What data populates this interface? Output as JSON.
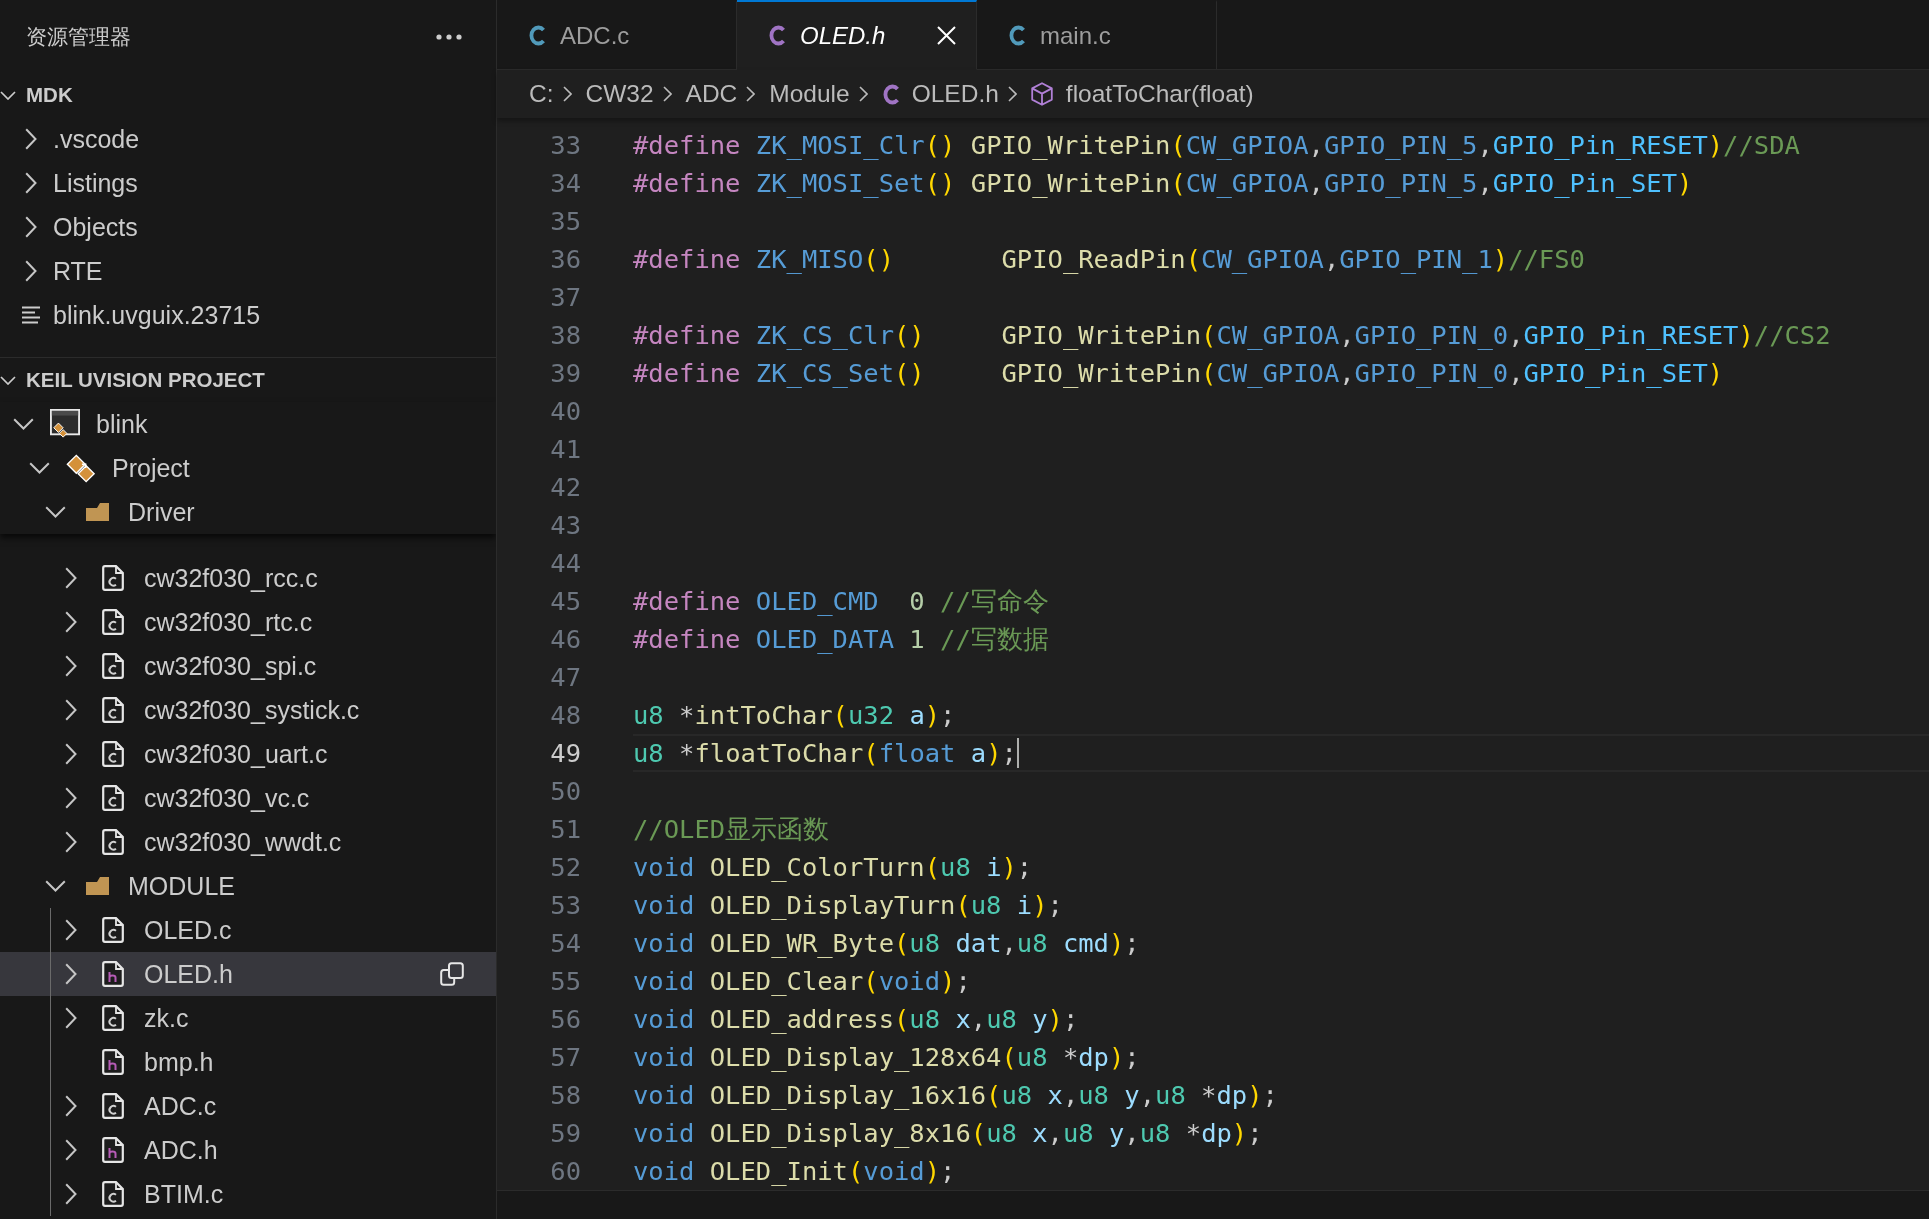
{
  "sidebar": {
    "title": "资源管理器",
    "sections": [
      {
        "title": "MDK",
        "kind": "explorer",
        "expanded": true,
        "items": [
          {
            "label": ".vscode",
            "kind": "dir",
            "expandable": true,
            "expanded": false,
            "selected": false
          },
          {
            "label": "Listings",
            "kind": "dir",
            "expandable": true,
            "expanded": false,
            "selected": false
          },
          {
            "label": "Objects",
            "kind": "dir",
            "expandable": true,
            "expanded": false,
            "selected": false
          },
          {
            "label": "RTE",
            "kind": "dir",
            "expandable": true,
            "expanded": false,
            "selected": false
          },
          {
            "label": "blink.uvguix.23715",
            "kind": "text-file",
            "expandable": false,
            "selected": false
          }
        ]
      },
      {
        "title": "KEIL UVISION PROJECT",
        "kind": "project",
        "expanded": true,
        "items": [
          {
            "label": "blink",
            "kind": "target",
            "expandable": true,
            "expanded": true,
            "selected": false,
            "children": [
              {
                "label": "Project",
                "kind": "project",
                "expandable": true,
                "expanded": true,
                "selected": false,
                "children": [
                  {
                    "label": "Driver",
                    "kind": "folder",
                    "expandable": true,
                    "expanded": true,
                    "selected": false,
                    "children": [
                      {
                        "label": "cw32f030_rcc.c",
                        "kind": "c-file",
                        "expandable": true,
                        "expanded": false,
                        "selected": false
                      },
                      {
                        "label": "cw32f030_rtc.c",
                        "kind": "c-file",
                        "expandable": true,
                        "expanded": false,
                        "selected": false
                      },
                      {
                        "label": "cw32f030_spi.c",
                        "kind": "c-file",
                        "expandable": true,
                        "expanded": false,
                        "selected": false
                      },
                      {
                        "label": "cw32f030_systick.c",
                        "kind": "c-file",
                        "expandable": true,
                        "expanded": false,
                        "selected": false
                      },
                      {
                        "label": "cw32f030_uart.c",
                        "kind": "c-file",
                        "expandable": true,
                        "expanded": false,
                        "selected": false
                      },
                      {
                        "label": "cw32f030_vc.c",
                        "kind": "c-file",
                        "expandable": true,
                        "expanded": false,
                        "selected": false
                      },
                      {
                        "label": "cw32f030_wwdt.c",
                        "kind": "c-file",
                        "expandable": true,
                        "expanded": false,
                        "selected": false
                      }
                    ]
                  },
                  {
                    "label": "MODULE",
                    "kind": "folder",
                    "expandable": true,
                    "expanded": true,
                    "selected": false,
                    "children": [
                      {
                        "label": "OLED.c",
                        "kind": "c-file",
                        "expandable": true,
                        "expanded": false,
                        "selected": false
                      },
                      {
                        "label": "OLED.h",
                        "kind": "h-file",
                        "expandable": true,
                        "expanded": false,
                        "selected": true
                      },
                      {
                        "label": "zk.c",
                        "kind": "c-file",
                        "expandable": true,
                        "expanded": false,
                        "selected": false
                      },
                      {
                        "label": "bmp.h",
                        "kind": "h-file",
                        "expandable": false,
                        "selected": false
                      },
                      {
                        "label": "ADC.c",
                        "kind": "c-file",
                        "expandable": true,
                        "expanded": false,
                        "selected": false
                      },
                      {
                        "label": "ADC.h",
                        "kind": "h-file",
                        "expandable": true,
                        "expanded": false,
                        "selected": false
                      },
                      {
                        "label": "BTIM.c",
                        "kind": "c-file",
                        "expandable": true,
                        "expanded": false,
                        "selected": false
                      }
                    ]
                  }
                ]
              }
            ]
          }
        ]
      }
    ]
  },
  "tabs": [
    {
      "label": "ADC.c",
      "kind": "source",
      "selected": false,
      "preview": false
    },
    {
      "label": "OLED.h",
      "kind": "header",
      "selected": true,
      "preview": true
    },
    {
      "label": "main.c",
      "kind": "source",
      "selected": false,
      "preview": false
    }
  ],
  "breadcrumbs": [
    {
      "label": "C:",
      "kind": "folder"
    },
    {
      "label": "CW32",
      "kind": "folder"
    },
    {
      "label": "ADC",
      "kind": "folder"
    },
    {
      "label": "Module",
      "kind": "folder"
    },
    {
      "label": "OLED.h",
      "kind": "header"
    },
    {
      "label": "floatToChar(float)",
      "kind": "function"
    }
  ],
  "editor": {
    "lines": [
      {
        "number": "33",
        "active": false,
        "tokens": [
          {
            "kind": "directive",
            "text": "#define "
          },
          {
            "kind": "macro",
            "text": "ZK_MOSI_Clr"
          },
          {
            "kind": "bracket",
            "text": "() "
          },
          {
            "kind": "function",
            "text": "GPIO_WritePin"
          },
          {
            "kind": "bracket",
            "text": "("
          },
          {
            "kind": "macro",
            "text": "CW_GPIOA"
          },
          {
            "kind": "plain",
            "text": ","
          },
          {
            "kind": "macro",
            "text": "GPIO_PIN_5"
          },
          {
            "kind": "plain",
            "text": ","
          },
          {
            "kind": "constant",
            "text": "GPIO_Pin_RESET"
          },
          {
            "kind": "bracket",
            "text": ")"
          },
          {
            "kind": "comment",
            "text": "//SDA"
          }
        ]
      },
      {
        "number": "34",
        "active": false,
        "tokens": [
          {
            "kind": "directive",
            "text": "#define "
          },
          {
            "kind": "macro",
            "text": "ZK_MOSI_Set"
          },
          {
            "kind": "bracket",
            "text": "() "
          },
          {
            "kind": "function",
            "text": "GPIO_WritePin"
          },
          {
            "kind": "bracket",
            "text": "("
          },
          {
            "kind": "macro",
            "text": "CW_GPIOA"
          },
          {
            "kind": "plain",
            "text": ","
          },
          {
            "kind": "macro",
            "text": "GPIO_PIN_5"
          },
          {
            "kind": "plain",
            "text": ","
          },
          {
            "kind": "constant",
            "text": "GPIO_Pin_SET"
          },
          {
            "kind": "bracket",
            "text": ")"
          }
        ]
      },
      {
        "number": "35",
        "active": false
      },
      {
        "number": "36",
        "active": false,
        "tokens": [
          {
            "kind": "directive",
            "text": "#define "
          },
          {
            "kind": "macro",
            "text": "ZK_MISO"
          },
          {
            "kind": "bracket",
            "text": "()       "
          },
          {
            "kind": "function",
            "text": "GPIO_ReadPin"
          },
          {
            "kind": "bracket",
            "text": "("
          },
          {
            "kind": "macro",
            "text": "CW_GPIOA"
          },
          {
            "kind": "plain",
            "text": ","
          },
          {
            "kind": "macro",
            "text": "GPIO_PIN_1"
          },
          {
            "kind": "bracket",
            "text": ")"
          },
          {
            "kind": "comment",
            "text": "//FS0"
          }
        ]
      },
      {
        "number": "37",
        "active": false
      },
      {
        "number": "38",
        "active": false,
        "tokens": [
          {
            "kind": "directive",
            "text": "#define "
          },
          {
            "kind": "macro",
            "text": "ZK_CS_Clr"
          },
          {
            "kind": "bracket",
            "text": "()     "
          },
          {
            "kind": "function",
            "text": "GPIO_WritePin"
          },
          {
            "kind": "bracket",
            "text": "("
          },
          {
            "kind": "macro",
            "text": "CW_GPIOA"
          },
          {
            "kind": "plain",
            "text": ","
          },
          {
            "kind": "macro",
            "text": "GPIO_PIN_0"
          },
          {
            "kind": "plain",
            "text": ","
          },
          {
            "kind": "constant",
            "text": "GPIO_Pin_RESET"
          },
          {
            "kind": "bracket",
            "text": ")"
          },
          {
            "kind": "comment",
            "text": "//CS2"
          }
        ]
      },
      {
        "number": "39",
        "active": false,
        "tokens": [
          {
            "kind": "directive",
            "text": "#define "
          },
          {
            "kind": "macro",
            "text": "ZK_CS_Set"
          },
          {
            "kind": "bracket",
            "text": "()     "
          },
          {
            "kind": "function",
            "text": "GPIO_WritePin"
          },
          {
            "kind": "bracket",
            "text": "("
          },
          {
            "kind": "macro",
            "text": "CW_GPIOA"
          },
          {
            "kind": "plain",
            "text": ","
          },
          {
            "kind": "macro",
            "text": "GPIO_PIN_0"
          },
          {
            "kind": "plain",
            "text": ","
          },
          {
            "kind": "constant",
            "text": "GPIO_Pin_SET"
          },
          {
            "kind": "bracket",
            "text": ")"
          }
        ]
      },
      {
        "number": "40",
        "active": false
      },
      {
        "number": "41",
        "active": false
      },
      {
        "number": "42",
        "active": false
      },
      {
        "number": "43",
        "active": false
      },
      {
        "number": "44",
        "active": false
      },
      {
        "number": "45",
        "active": false,
        "tokens": [
          {
            "kind": "directive",
            "text": "#define "
          },
          {
            "kind": "macro",
            "text": "OLED_CMD  "
          },
          {
            "kind": "number",
            "text": "0 "
          },
          {
            "kind": "comment",
            "text": "//写命令"
          }
        ]
      },
      {
        "number": "46",
        "active": false,
        "tokens": [
          {
            "kind": "directive",
            "text": "#define "
          },
          {
            "kind": "macro",
            "text": "OLED_DATA "
          },
          {
            "kind": "number",
            "text": "1 "
          },
          {
            "kind": "comment",
            "text": "//写数据"
          }
        ]
      },
      {
        "number": "47",
        "active": false
      },
      {
        "number": "48",
        "active": false,
        "tokens": [
          {
            "kind": "type",
            "text": "u8"
          },
          {
            "kind": "plain",
            "text": " *"
          },
          {
            "kind": "function",
            "text": "intToChar"
          },
          {
            "kind": "bracket",
            "text": "("
          },
          {
            "kind": "type",
            "text": "u32 "
          },
          {
            "kind": "param",
            "text": "a"
          },
          {
            "kind": "bracket",
            "text": ")"
          },
          {
            "kind": "plain",
            "text": ";"
          }
        ]
      },
      {
        "number": "49",
        "active": true,
        "tokens": [
          {
            "kind": "type",
            "text": "u8"
          },
          {
            "kind": "plain",
            "text": " *"
          },
          {
            "kind": "function",
            "text": "floatToChar"
          },
          {
            "kind": "bracket",
            "text": "("
          },
          {
            "kind": "keyword",
            "text": "float "
          },
          {
            "kind": "param",
            "text": "a"
          },
          {
            "kind": "bracket",
            "text": ")"
          },
          {
            "kind": "plain",
            "text": ";"
          }
        ]
      },
      {
        "number": "50",
        "active": false
      },
      {
        "number": "51",
        "active": false,
        "tokens": [
          {
            "kind": "comment",
            "text": "//OLED显示函数"
          }
        ]
      },
      {
        "number": "52",
        "active": false,
        "tokens": [
          {
            "kind": "keyword",
            "text": "void "
          },
          {
            "kind": "function",
            "text": "OLED_ColorTurn"
          },
          {
            "kind": "bracket",
            "text": "("
          },
          {
            "kind": "type",
            "text": "u8 "
          },
          {
            "kind": "param",
            "text": "i"
          },
          {
            "kind": "bracket",
            "text": ")"
          },
          {
            "kind": "plain",
            "text": ";"
          }
        ]
      },
      {
        "number": "53",
        "active": false,
        "tokens": [
          {
            "kind": "keyword",
            "text": "void "
          },
          {
            "kind": "function",
            "text": "OLED_DisplayTurn"
          },
          {
            "kind": "bracket",
            "text": "("
          },
          {
            "kind": "type",
            "text": "u8 "
          },
          {
            "kind": "param",
            "text": "i"
          },
          {
            "kind": "bracket",
            "text": ")"
          },
          {
            "kind": "plain",
            "text": ";"
          }
        ]
      },
      {
        "number": "54",
        "active": false,
        "tokens": [
          {
            "kind": "keyword",
            "text": "void "
          },
          {
            "kind": "function",
            "text": "OLED_WR_Byte"
          },
          {
            "kind": "bracket",
            "text": "("
          },
          {
            "kind": "type",
            "text": "u8 "
          },
          {
            "kind": "param",
            "text": "dat"
          },
          {
            "kind": "plain",
            "text": ","
          },
          {
            "kind": "type",
            "text": "u8 "
          },
          {
            "kind": "param",
            "text": "cmd"
          },
          {
            "kind": "bracket",
            "text": ")"
          },
          {
            "kind": "plain",
            "text": ";"
          }
        ]
      },
      {
        "number": "55",
        "active": false,
        "tokens": [
          {
            "kind": "keyword",
            "text": "void "
          },
          {
            "kind": "function",
            "text": "OLED_Clear"
          },
          {
            "kind": "bracket",
            "text": "("
          },
          {
            "kind": "keyword",
            "text": "void"
          },
          {
            "kind": "bracket",
            "text": ")"
          },
          {
            "kind": "plain",
            "text": ";"
          }
        ]
      },
      {
        "number": "56",
        "active": false,
        "tokens": [
          {
            "kind": "keyword",
            "text": "void "
          },
          {
            "kind": "function",
            "text": "OLED_address"
          },
          {
            "kind": "bracket",
            "text": "("
          },
          {
            "kind": "type",
            "text": "u8 "
          },
          {
            "kind": "param",
            "text": "x"
          },
          {
            "kind": "plain",
            "text": ","
          },
          {
            "kind": "type",
            "text": "u8 "
          },
          {
            "kind": "param",
            "text": "y"
          },
          {
            "kind": "bracket",
            "text": ")"
          },
          {
            "kind": "plain",
            "text": ";"
          }
        ]
      },
      {
        "number": "57",
        "active": false,
        "tokens": [
          {
            "kind": "keyword",
            "text": "void "
          },
          {
            "kind": "function",
            "text": "OLED_Display_128x64"
          },
          {
            "kind": "bracket",
            "text": "("
          },
          {
            "kind": "type",
            "text": "u8"
          },
          {
            "kind": "plain",
            "text": " *"
          },
          {
            "kind": "param",
            "text": "dp"
          },
          {
            "kind": "bracket",
            "text": ")"
          },
          {
            "kind": "plain",
            "text": ";"
          }
        ]
      },
      {
        "number": "58",
        "active": false,
        "tokens": [
          {
            "kind": "keyword",
            "text": "void "
          },
          {
            "kind": "function",
            "text": "OLED_Display_16x16"
          },
          {
            "kind": "bracket",
            "text": "("
          },
          {
            "kind": "type",
            "text": "u8 "
          },
          {
            "kind": "param",
            "text": "x"
          },
          {
            "kind": "plain",
            "text": ","
          },
          {
            "kind": "type",
            "text": "u8 "
          },
          {
            "kind": "param",
            "text": "y"
          },
          {
            "kind": "plain",
            "text": ","
          },
          {
            "kind": "type",
            "text": "u8"
          },
          {
            "kind": "plain",
            "text": " *"
          },
          {
            "kind": "param",
            "text": "dp"
          },
          {
            "kind": "bracket",
            "text": ")"
          },
          {
            "kind": "plain",
            "text": ";"
          }
        ]
      },
      {
        "number": "59",
        "active": false,
        "tokens": [
          {
            "kind": "keyword",
            "text": "void "
          },
          {
            "kind": "function",
            "text": "OLED_Display_8x16"
          },
          {
            "kind": "bracket",
            "text": "("
          },
          {
            "kind": "type",
            "text": "u8 "
          },
          {
            "kind": "param",
            "text": "x"
          },
          {
            "kind": "plain",
            "text": ","
          },
          {
            "kind": "type",
            "text": "u8 "
          },
          {
            "kind": "param",
            "text": "y"
          },
          {
            "kind": "plain",
            "text": ","
          },
          {
            "kind": "type",
            "text": "u8"
          },
          {
            "kind": "plain",
            "text": " *"
          },
          {
            "kind": "param",
            "text": "dp"
          },
          {
            "kind": "bracket",
            "text": ")"
          },
          {
            "kind": "plain",
            "text": ";"
          }
        ]
      },
      {
        "number": "60",
        "active": false,
        "tokens": [
          {
            "kind": "keyword",
            "text": "void "
          },
          {
            "kind": "function",
            "text": "OLED_Init"
          },
          {
            "kind": "bracket",
            "text": "("
          },
          {
            "kind": "keyword",
            "text": "void"
          },
          {
            "kind": "bracket",
            "text": ")"
          },
          {
            "kind": "plain",
            "text": ";"
          }
        ]
      }
    ]
  }
}
